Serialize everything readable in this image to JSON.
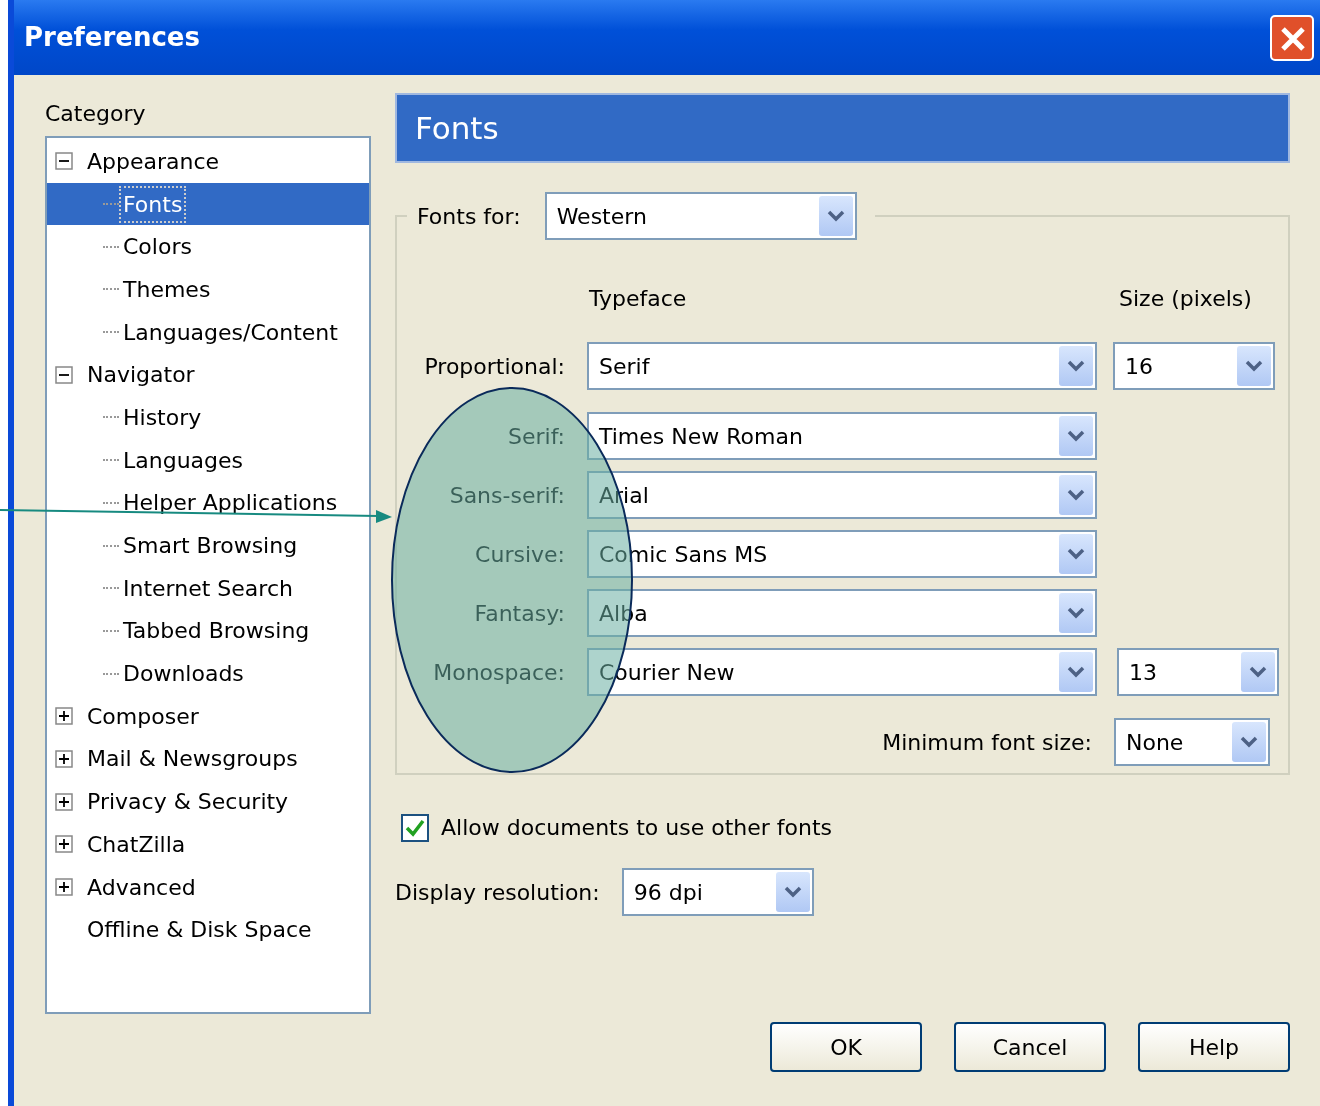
{
  "window": {
    "title": "Preferences"
  },
  "category": {
    "label": "Category",
    "tree": [
      {
        "label": "Appearance",
        "kind": "group",
        "expanded": true,
        "selected": false,
        "children": [
          {
            "label": "Fonts",
            "selected": true
          },
          {
            "label": "Colors",
            "selected": false
          },
          {
            "label": "Themes",
            "selected": false
          },
          {
            "label": "Languages/Content",
            "selected": false
          }
        ]
      },
      {
        "label": "Navigator",
        "kind": "group",
        "expanded": true,
        "selected": false,
        "children": [
          {
            "label": "History",
            "selected": false
          },
          {
            "label": "Languages",
            "selected": false
          },
          {
            "label": "Helper Applications",
            "selected": false
          },
          {
            "label": "Smart Browsing",
            "selected": false
          },
          {
            "label": "Internet Search",
            "selected": false
          },
          {
            "label": "Tabbed Browsing",
            "selected": false
          },
          {
            "label": "Downloads",
            "selected": false
          }
        ]
      },
      {
        "label": "Composer",
        "kind": "group",
        "expanded": false,
        "selected": false
      },
      {
        "label": "Mail & Newsgroups",
        "kind": "group",
        "expanded": false,
        "selected": false
      },
      {
        "label": "Privacy & Security",
        "kind": "group",
        "expanded": false,
        "selected": false
      },
      {
        "label": "ChatZilla",
        "kind": "group",
        "expanded": false,
        "selected": false
      },
      {
        "label": "Advanced",
        "kind": "group",
        "expanded": false,
        "selected": false
      },
      {
        "label": "Offline & Disk Space",
        "kind": "leaf",
        "selected": false
      }
    ]
  },
  "panel": {
    "title": "Fonts",
    "fonts_for": {
      "label": "Fonts for:",
      "value": "Western"
    },
    "typeface_heading": "Typeface",
    "size_heading": "Size (pixels)",
    "rows": [
      {
        "label": "Proportional:",
        "typeface": "Serif",
        "size": "16"
      },
      {
        "label": "Serif:",
        "typeface": "Times New Roman"
      },
      {
        "label": "Sans-serif:",
        "typeface": "Arial"
      },
      {
        "label": "Cursive:",
        "typeface": "Comic Sans MS"
      },
      {
        "label": "Fantasy:",
        "typeface": "Alba"
      },
      {
        "label": "Monospace:",
        "typeface": "Courier New",
        "size": "13"
      }
    ],
    "minimum": {
      "label": "Minimum font size:",
      "value": "None"
    },
    "allow": {
      "label": "Allow documents to use other fonts",
      "checked": true
    },
    "resolution": {
      "label": "Display resolution:",
      "value": "96 dpi"
    }
  },
  "buttons": [
    {
      "label": "OK"
    },
    {
      "label": "Cancel"
    },
    {
      "label": "Help"
    }
  ]
}
